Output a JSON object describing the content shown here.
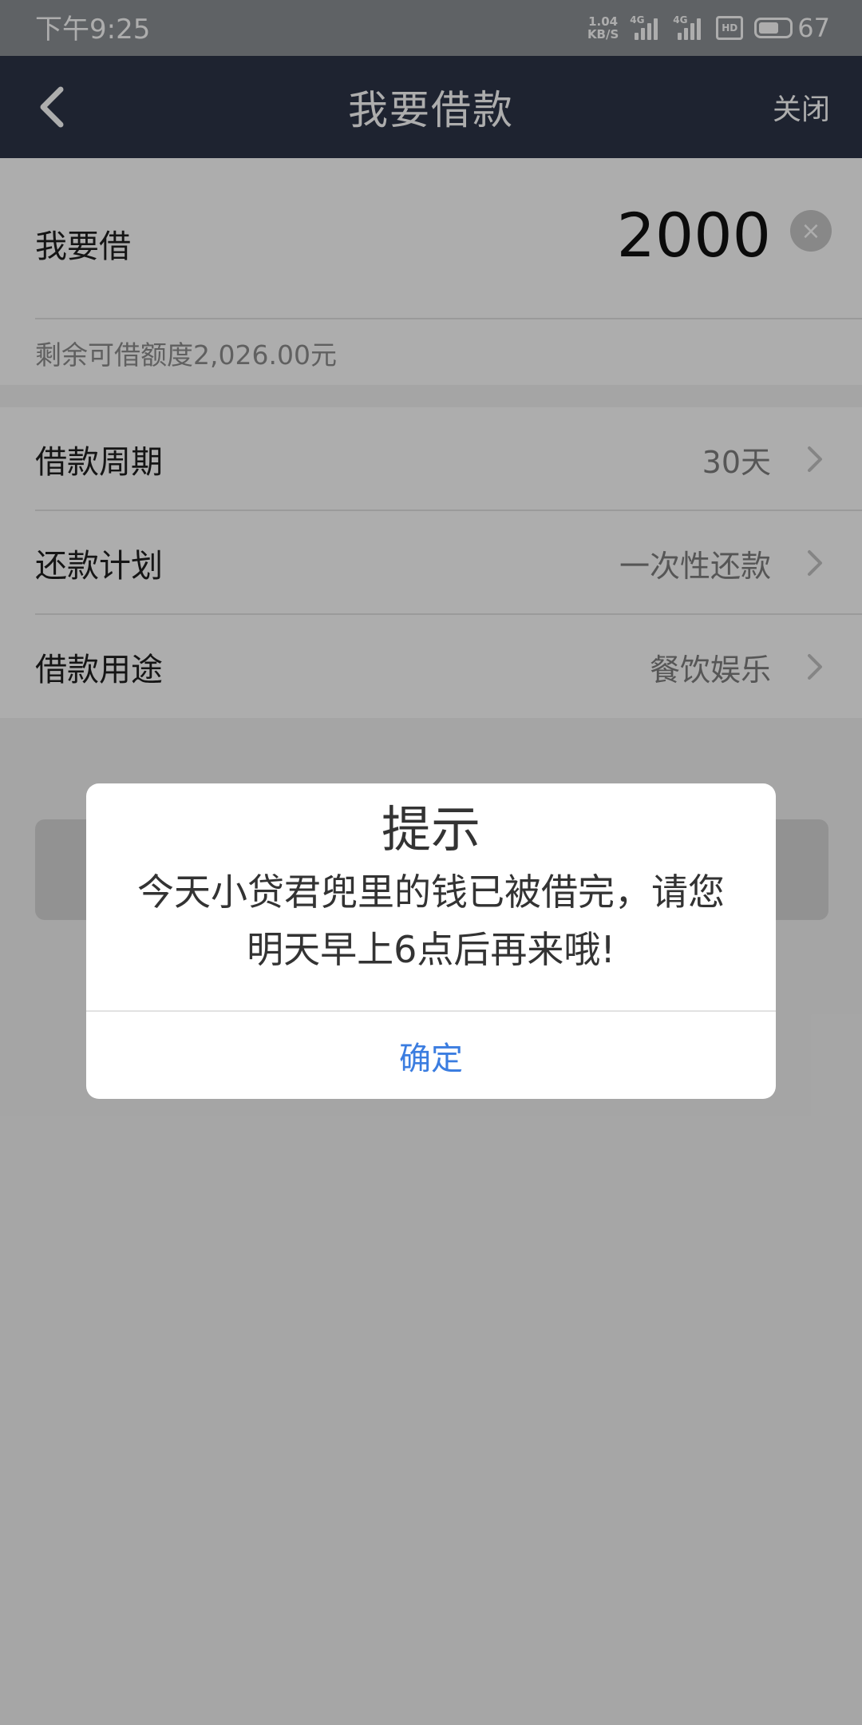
{
  "status_bar": {
    "time": "下午9:25",
    "net_speed_value": "1.04",
    "net_speed_unit": "KB/S",
    "signal1_tag": "4G",
    "signal2_tag": "4G",
    "hd_label": "HD",
    "battery_level": "67",
    "icons": [
      "signal-icon",
      "signal-icon",
      "hd-icon",
      "battery-icon"
    ]
  },
  "nav": {
    "title": "我要借款",
    "close_label": "关闭",
    "back_icon": "chevron-left-icon"
  },
  "amount": {
    "label": "我要借",
    "value": "2000",
    "clear_icon": "×",
    "remaining_text": "剩余可借额度2,026.00元"
  },
  "options": [
    {
      "label": "借款周期",
      "value": "30天"
    },
    {
      "label": "还款计划",
      "value": "一次性还款"
    },
    {
      "label": "借款用途",
      "value": "餐饮娱乐"
    }
  ],
  "dialog": {
    "title": "提示",
    "message_line1": "今天小贷君兜里的钱已被借完，请您",
    "message_line2": "明天早上6点后再来哦!",
    "confirm_label": "确定"
  },
  "colors": {
    "nav_bg": "#2d3448",
    "status_bg": "#8d9196",
    "confirm_text": "#3b7de0",
    "overlay": "rgba(0,0,0,0.32)"
  }
}
